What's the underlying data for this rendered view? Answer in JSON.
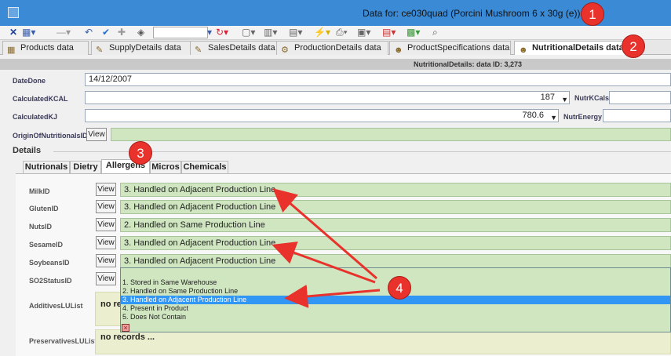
{
  "window": {
    "title": "Data for: ce030quad (Porcini Mushroom 6 x 30g (e))"
  },
  "page_tabs": [
    {
      "label": "Products data"
    },
    {
      "label": "SupplyDetails data"
    },
    {
      "label": "SalesDetails data"
    },
    {
      "label": "ProductionDetails data"
    },
    {
      "label": "ProductSpecifications data"
    },
    {
      "label": "NutritionalDetails data"
    }
  ],
  "infobar": {
    "text": "NutritionalDetails: data ID: 3,273"
  },
  "fields": {
    "datedone": {
      "label": "DateDone",
      "value": "14/12/2007"
    },
    "kcal": {
      "label": "CalculatedKCAL",
      "value": "187",
      "side_label": "NutrKCals"
    },
    "kj": {
      "label": "CalculatedKJ",
      "value": "780.6",
      "side_label": "NutrEnergy"
    },
    "origin": {
      "label": "OriginOfNutritionalsID",
      "view": "View"
    }
  },
  "details": {
    "title": "Details",
    "tabs": [
      {
        "label": "Nutrionals"
      },
      {
        "label": "Dietry"
      },
      {
        "label": "Allergens"
      },
      {
        "label": "Micros"
      },
      {
        "label": "Chemicals"
      }
    ]
  },
  "allergens": [
    {
      "label": "MilkID",
      "view": "View",
      "value": "3. Handled on Adjacent Production Line"
    },
    {
      "label": "GlutenID",
      "view": "View",
      "value": "3. Handled on Adjacent Production Line"
    },
    {
      "label": "NutsID",
      "view": "View",
      "value": "2. Handled on Same Production Line"
    },
    {
      "label": "SesameID",
      "view": "View",
      "value": "3. Handled on Adjacent Production Line"
    },
    {
      "label": "SoybeansID",
      "view": "View",
      "value": "3. Handled on Adjacent Production Line"
    },
    {
      "label": "SO2StatusID",
      "view": "View",
      "value": ""
    }
  ],
  "dropdown_options": [
    "1. Stored in Same Warehouse",
    "2. Handled on Same Production Line",
    "3. Handled on Adjacent Production Line",
    "4. Present in Product",
    "5. Does Not Contain"
  ],
  "additives": {
    "label": "AdditivesLUList",
    "text": "no rec"
  },
  "preservatives": {
    "label": "PreservativesLUList",
    "text": "no records ..."
  },
  "badges": [
    "1",
    "2",
    "3",
    "4"
  ],
  "colors": {
    "titlebar": "#3a8ad6",
    "field_green": "#cfe6c1",
    "selection": "#3296f5",
    "arrow_red": "#e8322b"
  },
  "icons": {
    "close": "close-icon",
    "save": "check-icon",
    "refresh": "refresh-icon",
    "binoculars": "binoculars-icon"
  }
}
